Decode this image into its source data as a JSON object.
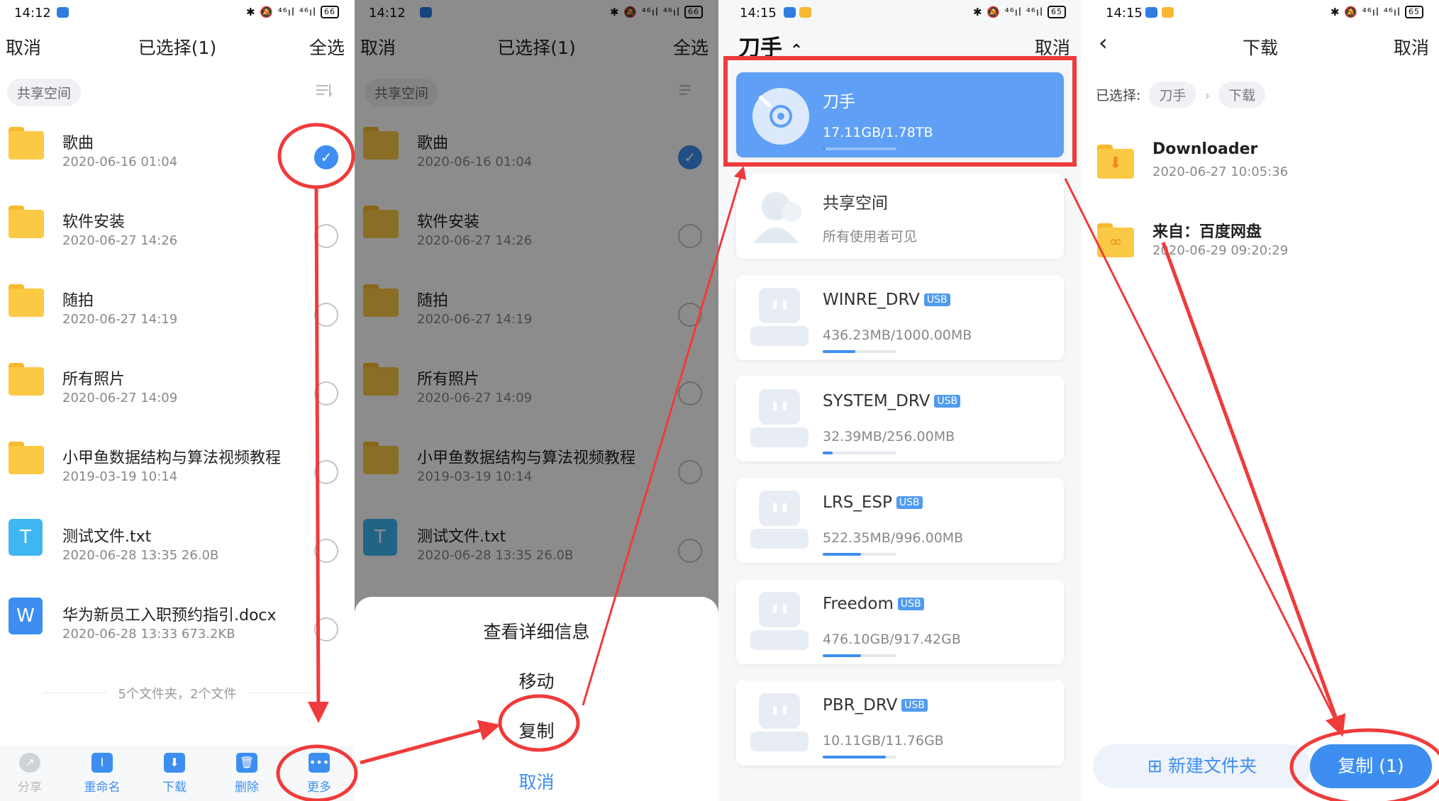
{
  "colors": {
    "accent": "#3d8ef0",
    "annotation": "#ef3b3b",
    "folder": "#fcc945"
  },
  "status": {
    "time_p1": "14:12",
    "time_p2": "14:12",
    "time_p3": "14:15",
    "time_p4": "14:15",
    "battery_a": "66",
    "battery_b": "65",
    "indicators": "✱ 🔕 ⁴⁶ıl ⁴⁶ıl"
  },
  "select_screen": {
    "cancel": "取消",
    "title": "已选择(1)",
    "select_all": "全选",
    "chip": "共享空间",
    "rows": [
      {
        "name": "歌曲",
        "meta": "2020-06-16   01:04",
        "icon": "folder-icon",
        "checked": true
      },
      {
        "name": "软件安装",
        "meta": "2020-06-27   14:26",
        "icon": "folder-icon",
        "checked": false
      },
      {
        "name": "随拍",
        "meta": "2020-06-27   14:19",
        "icon": "folder-icon",
        "checked": false
      },
      {
        "name": "所有照片",
        "meta": "2020-06-27   14:09",
        "icon": "folder-icon",
        "checked": false
      },
      {
        "name": "小甲鱼数据结构与算法视频教程",
        "meta": "2019-03-19   10:14",
        "icon": "folder-icon",
        "checked": false
      },
      {
        "name": "测试文件.txt",
        "meta": "2020-06-28   13:35     26.0B",
        "icon": "txt-file-icon",
        "glyph": "T",
        "checked": false
      },
      {
        "name": "华为新员工入职预约指引.docx",
        "meta": "2020-06-28   13:33     673.2KB",
        "icon": "word-file-icon",
        "glyph": "W",
        "checked": false
      }
    ],
    "summary": "5个文件夹，2个文件",
    "toolbar": [
      {
        "label": "分享",
        "glyph": "↗",
        "icon": "share-icon",
        "disabled": true
      },
      {
        "label": "重命名",
        "glyph": "I",
        "icon": "rename-icon",
        "disabled": false
      },
      {
        "label": "下载",
        "glyph": "⬇",
        "icon": "download-icon",
        "disabled": false
      },
      {
        "label": "删除",
        "glyph": "🗑",
        "icon": "delete-icon",
        "disabled": false
      },
      {
        "label": "更多",
        "glyph": "•••",
        "icon": "more-icon",
        "disabled": false
      }
    ]
  },
  "action_sheet": {
    "details": "查看详细信息",
    "move": "移动",
    "copy": "复制",
    "cancel": "取消"
  },
  "drive_screen": {
    "title": "刀手",
    "caret": "⌃",
    "cancel": "取消",
    "drives": [
      {
        "name": "刀手",
        "sub": "17.11GB/1.78TB",
        "usb": false,
        "active": true,
        "progress": 0.01
      },
      {
        "name": "共享空间",
        "sub": "所有使用者可见",
        "usb": false,
        "active": false,
        "shared": true
      },
      {
        "name": "WINRE_DRV",
        "sub": "436.23MB/1000.00MB",
        "usb": true,
        "usb_label": "USB",
        "progress": 0.44
      },
      {
        "name": "SYSTEM_DRV",
        "sub": "32.39MB/256.00MB",
        "usb": true,
        "usb_label": "USB",
        "progress": 0.13
      },
      {
        "name": "LRS_ESP",
        "sub": "522.35MB/996.00MB",
        "usb": true,
        "usb_label": "USB",
        "progress": 0.52
      },
      {
        "name": "Freedom",
        "sub": "476.10GB/917.42GB",
        "usb": true,
        "usb_label": "USB",
        "progress": 0.52
      },
      {
        "name": "PBR_DRV",
        "sub": "10.11GB/11.76GB",
        "usb": true,
        "usb_label": "USB",
        "progress": 0.86
      }
    ]
  },
  "download_screen": {
    "back": "‹",
    "title": "下载",
    "cancel": "取消",
    "selected_label": "已选择:",
    "crumb1": "刀手",
    "crumb_sep": "›",
    "crumb2": "下载",
    "folders": [
      {
        "name": "Downloader",
        "meta": "2020-06-27 10:05:36",
        "glyph": "⬇"
      },
      {
        "name": "来自：百度网盘",
        "meta": "2020-06-29 09:20:29",
        "glyph": "∞"
      }
    ],
    "new_folder": "新建文件夹",
    "new_folder_glyph": "⊞",
    "copy_button": "复制 (1)"
  }
}
